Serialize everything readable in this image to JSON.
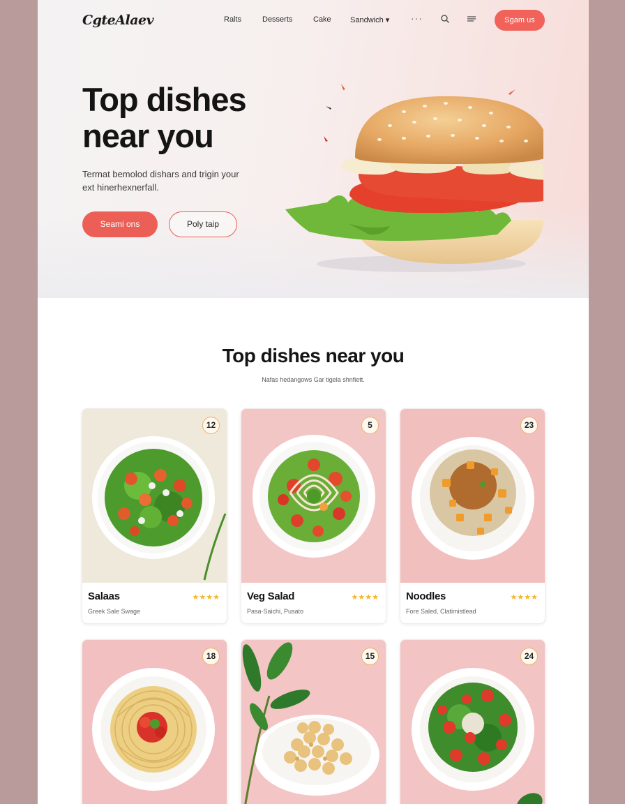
{
  "brand": {
    "logo": "CgteAlaev",
    "accent": "#f0625a"
  },
  "nav": {
    "links": [
      "Ralts",
      "Desserts",
      "Cake",
      "Sandwich"
    ],
    "more": "···",
    "search_icon": "search-icon",
    "menu_icon": "menu-icon",
    "cta": "Sgam us"
  },
  "hero": {
    "title": "Top dishes near you",
    "subtitle": "Termat bemolod dishars and trigin your ext hinerhexnerfall.",
    "primary_button": "Seami ons",
    "secondary_button": "Poly taip"
  },
  "section": {
    "title": "Top dishes near you",
    "subtitle": "Nafas hedangows Gar tigela shnfiett."
  },
  "cards": [
    {
      "badge": "12",
      "name": "Salaas",
      "rating": "★★★★",
      "desc": "Greek Sale Swage"
    },
    {
      "badge": "5",
      "name": "Veg Salad",
      "rating": "★★★★",
      "desc": "Pasa-Saichi, Pusato"
    },
    {
      "badge": "23",
      "name": "Noodles",
      "rating": "★★★★",
      "desc": "Fore Saled, Clatimistlead"
    },
    {
      "badge": "18"
    },
    {
      "badge": "15"
    },
    {
      "badge": "24"
    }
  ]
}
